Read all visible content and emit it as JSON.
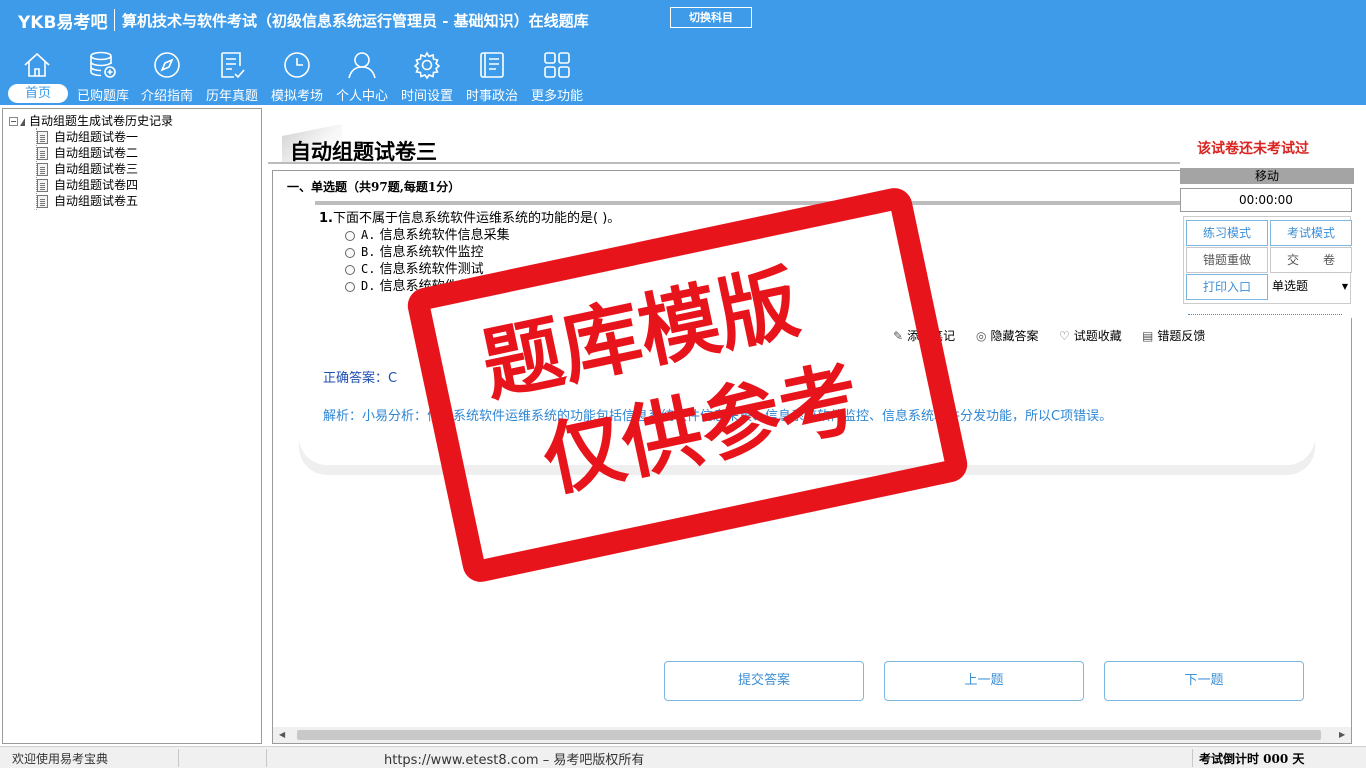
{
  "header": {
    "brand": "YKB易考吧",
    "title": "算机技术与软件考试（初级信息系统运行管理员 - 基础知识）在线题库",
    "switch_label": "切换科目"
  },
  "nav": [
    {
      "label": "首页",
      "icon": "home-icon"
    },
    {
      "label": "已购题库",
      "icon": "database-icon"
    },
    {
      "label": "介绍指南",
      "icon": "compass-icon"
    },
    {
      "label": "历年真题",
      "icon": "list-icon"
    },
    {
      "label": "模拟考场",
      "icon": "clock-icon"
    },
    {
      "label": "个人中心",
      "icon": "user-icon"
    },
    {
      "label": "时间设置",
      "icon": "gear-icon"
    },
    {
      "label": "时事政治",
      "icon": "news-icon"
    },
    {
      "label": "更多功能",
      "icon": "grid-icon"
    }
  ],
  "tree": {
    "root": "自动组题生成试卷历史记录",
    "items": [
      "自动组题试卷一",
      "自动组题试卷二",
      "自动组题试卷三",
      "自动组题试卷四",
      "自动组题试卷五"
    ]
  },
  "main": {
    "title": "自动组题试卷三",
    "status": "该试卷还未考试过",
    "section": "一、单选题（共97题,每题1分）",
    "question_number": "1.",
    "question": "下面不属于信息系统软件运维系统的功能的是( )。",
    "options": [
      {
        "key": "A.",
        "text": "信息系统软件信息采集"
      },
      {
        "key": "B.",
        "text": "信息系统软件监控"
      },
      {
        "key": "C.",
        "text": "信息系统软件测试"
      },
      {
        "key": "D.",
        "text": "信息系统软件分发功能"
      }
    ],
    "tools": {
      "note": "添加笔记",
      "hide_answer": "隐藏答案",
      "favorite": "试题收藏",
      "feedback": "错题反馈"
    },
    "answer": "正确答案：C",
    "analysis": "解析：小易分析：信息系统软件运维系统的功能包括信息系统软件信息采集、信息系统软件监控、信息系统软件分发功能，所以C项错误。",
    "buttons": {
      "submit": "提交答案",
      "prev": "上一题",
      "next": "下一题"
    }
  },
  "float_panel": {
    "move": "移动",
    "timer": "00:00:00",
    "practice_mode": "练习模式",
    "exam_mode": "考试模式",
    "redo_wrong": "错题重做",
    "hand_in": "交　　卷",
    "print": "打印入口",
    "type_select": "单选题"
  },
  "watermark": {
    "line1": "题库模版",
    "line2": "仅供参考"
  },
  "statusbar": {
    "welcome": "欢迎使用易考宝典",
    "url": "https://www.etest8.com – 易考吧版权所有",
    "countdown": "考试倒计时 000 天"
  }
}
